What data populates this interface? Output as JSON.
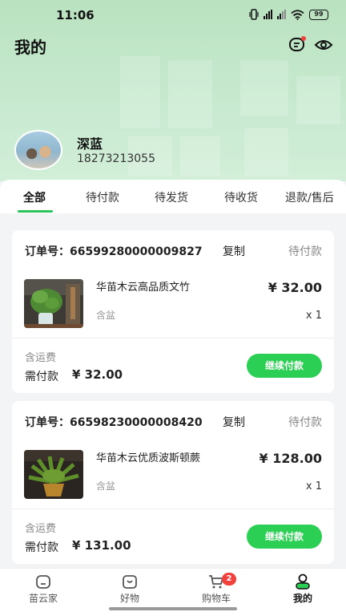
{
  "status_bar": {
    "time": "11:06",
    "battery": "99"
  },
  "header": {
    "title": "我的"
  },
  "user": {
    "name": "深蓝",
    "phone": "18273213055"
  },
  "tabs": [
    {
      "label": "全部"
    },
    {
      "label": "待付款"
    },
    {
      "label": "待发货"
    },
    {
      "label": "待收货"
    },
    {
      "label": "退款/售后"
    }
  ],
  "active_tab": "全部",
  "orders": [
    {
      "order_no_label": "订单号：",
      "order_no": "66599280000009827",
      "copy_label": "复制",
      "status": "待付款",
      "product_name": "华苗木云高品质文竹",
      "price": "¥ 32.00",
      "variant": "含盆",
      "quantity": "x 1",
      "shipping_note": "含运费",
      "pay_label": "需付款",
      "pay_amount": "¥ 32.00",
      "action_label": "继续付款"
    },
    {
      "order_no_label": "订单号：",
      "order_no": "66598230000008420",
      "copy_label": "复制",
      "status": "待付款",
      "product_name": "华苗木云优质波斯顿蕨",
      "price": "¥ 128.00",
      "variant": "含盆",
      "quantity": "x 1",
      "shipping_note": "含运费",
      "pay_label": "需付款",
      "pay_amount": "¥ 131.00",
      "action_label": "继续付款"
    }
  ],
  "bottom_nav": {
    "items": [
      {
        "label": "苗云家",
        "icon": "home-icon"
      },
      {
        "label": "好物",
        "icon": "bag-icon"
      },
      {
        "label": "购物车",
        "icon": "cart-icon",
        "badge": "2"
      },
      {
        "label": "我的",
        "icon": "person-icon"
      }
    ],
    "active": "我的"
  },
  "colors": {
    "accent": "#2bcf53",
    "header_bg": "#c3e7cb",
    "badge": "#f0413d"
  }
}
